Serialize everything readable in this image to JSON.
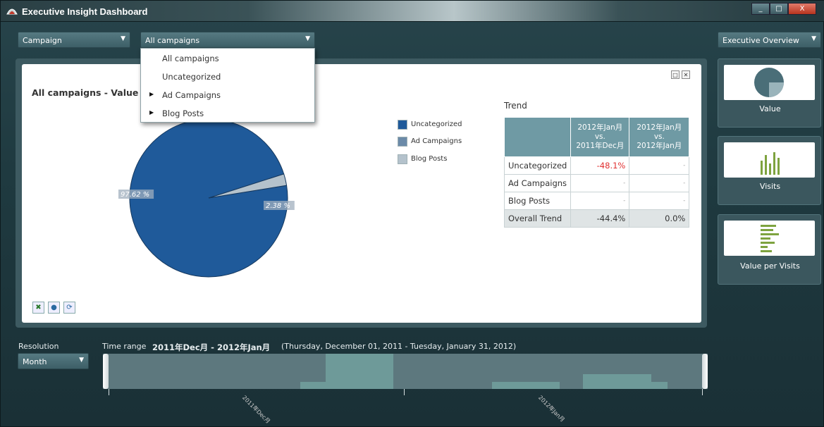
{
  "window": {
    "title": "Executive Insight Dashboard",
    "minimize": "_",
    "maximize": "□",
    "close": "X"
  },
  "filters": {
    "dimension": {
      "value": "Campaign"
    },
    "selection": {
      "value": "All campaigns"
    },
    "dropdown_items": [
      {
        "label": "All campaigns",
        "has_children": false
      },
      {
        "label": "Uncategorized",
        "has_children": false
      },
      {
        "label": "Ad Campaigns",
        "has_children": true
      },
      {
        "label": "Blog Posts",
        "has_children": true
      }
    ],
    "view": {
      "value": "Executive Overview"
    }
  },
  "card": {
    "title": "All campaigns - Value",
    "trend_label": "Trend"
  },
  "chart_data": {
    "type": "pie",
    "title": "",
    "slices": [
      {
        "label": "Uncategorized",
        "value": 97.62,
        "display": "97.62 %",
        "color": "#1f5a9a"
      },
      {
        "label": "Ad Campaigns",
        "value": 0,
        "display": "",
        "color": "#6b8aa8"
      },
      {
        "label": "Blog Posts",
        "value": 2.38,
        "display": "2.38 %",
        "color": "#b4c2cc"
      }
    ],
    "legend": [
      {
        "label": "Uncategorized",
        "color": "#1f5a9a"
      },
      {
        "label": "Ad Campaigns",
        "color": "#6b8aa8"
      },
      {
        "label": "Blog Posts",
        "color": "#b4c2cc"
      }
    ],
    "legend_position": "right"
  },
  "trend_table": {
    "headers": [
      {
        "l1": "2012年Jan月",
        "l2": "vs.",
        "l3": "2011年Dec月"
      },
      {
        "l1": "2012年Jan月",
        "l2": "vs.",
        "l3": "2012年Jan月"
      }
    ],
    "rows": [
      {
        "label": "Uncategorized",
        "c1": "-48.1%",
        "c2": "-"
      },
      {
        "label": "Ad Campaigns",
        "c1": "-",
        "c2": "-"
      },
      {
        "label": "Blog Posts",
        "c1": "-",
        "c2": "-"
      },
      {
        "label": "Overall Trend",
        "c1": "-44.4%",
        "c2": "0.0%"
      }
    ]
  },
  "side_panels": [
    {
      "label": "Value",
      "icon": "pie-chart-icon"
    },
    {
      "label": "Visits",
      "icon": "bar-chart-icon"
    },
    {
      "label": "Value per Visits",
      "icon": "horizontal-bar-chart-icon"
    }
  ],
  "bottom": {
    "resolution_label": "Resolution",
    "resolution_value": "Month",
    "time_range_label": "Time range",
    "time_range_value": "2011年Dec月 - 2012年Jan月",
    "time_range_dates": "(Thursday, December 01, 2011 - Tuesday, January 31, 2012)",
    "axis_labels": [
      "2011年Dec月",
      "2012年Jan月"
    ]
  },
  "colors": {
    "accent": "#1f5a9a",
    "negative": "#e03030",
    "table_header": "#6f9aa4"
  }
}
